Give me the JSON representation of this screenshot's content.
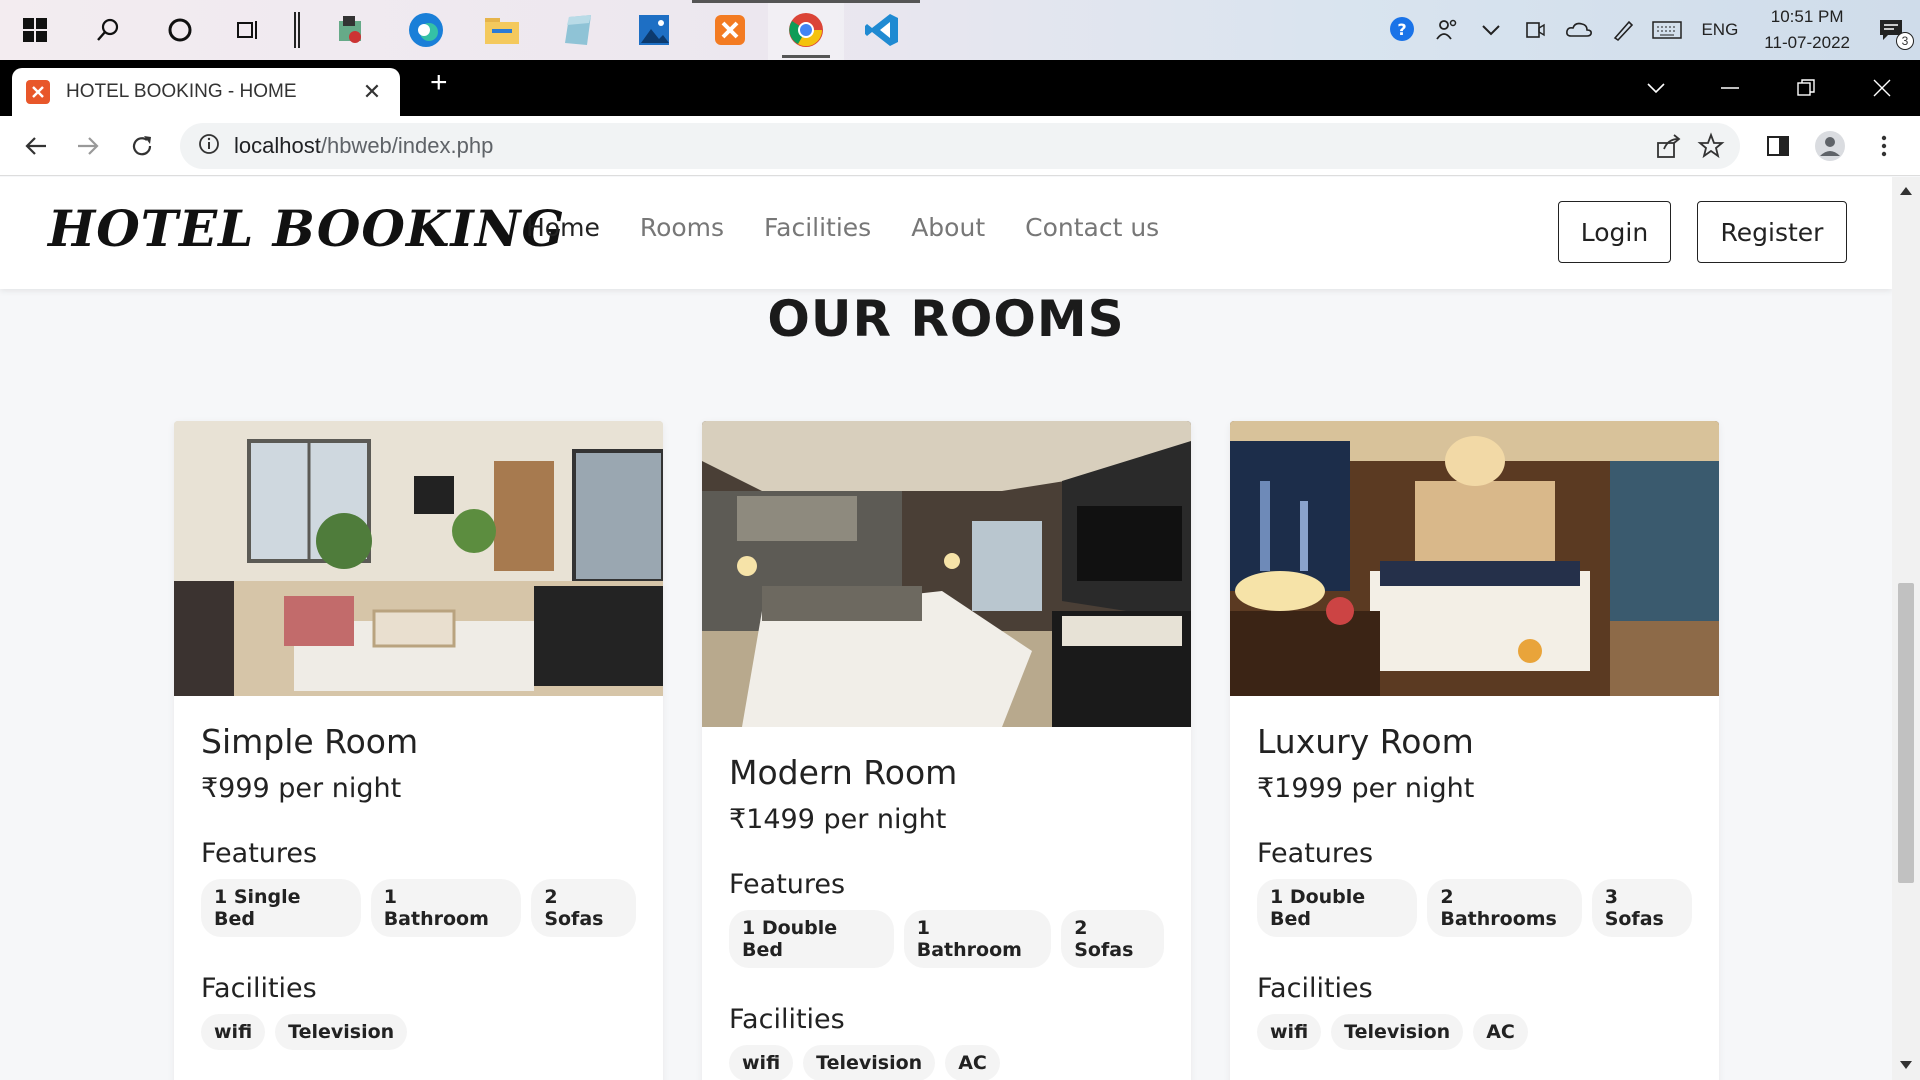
{
  "taskbar": {
    "language": "ENG",
    "time": "10:51 PM",
    "date": "11-07-2022",
    "notification_count": "3"
  },
  "browser": {
    "tab_title": "HOTEL BOOKING - HOME",
    "url_host": "localhost",
    "url_path": "/hbweb/index.php"
  },
  "site": {
    "brand": "HOTEL BOOKING",
    "nav": [
      "Home",
      "Rooms",
      "Facilities",
      "About",
      "Contact us"
    ],
    "login_label": "Login",
    "register_label": "Register",
    "section_title": "OUR ROOMS"
  },
  "rooms": [
    {
      "name": "Simple Room",
      "price": "₹999 per night",
      "features_label": "Features",
      "features": [
        "1 Single Bed",
        "1 Bathroom",
        "2 Sofas"
      ],
      "facilities_label": "Facilities",
      "facilities": [
        "wifi",
        "Television"
      ]
    },
    {
      "name": "Modern Room",
      "price": "₹1499 per night",
      "features_label": "Features",
      "features": [
        "1 Double Bed",
        "1 Bathroom",
        "2 Sofas"
      ],
      "facilities_label": "Facilities",
      "facilities": [
        "wifi",
        "Television",
        "AC"
      ]
    },
    {
      "name": "Luxury Room",
      "price": "₹1999 per night",
      "features_label": "Features",
      "features": [
        "1 Double Bed",
        "2 Bathrooms",
        "3 Sofas"
      ],
      "facilities_label": "Facilities",
      "facilities": [
        "wifi",
        "Television",
        "AC"
      ]
    }
  ],
  "colors": {
    "page_bg": "#f6f7f9",
    "brand_orange": "#e8572a",
    "text_dark": "#222222",
    "nav_muted": "#777777"
  }
}
